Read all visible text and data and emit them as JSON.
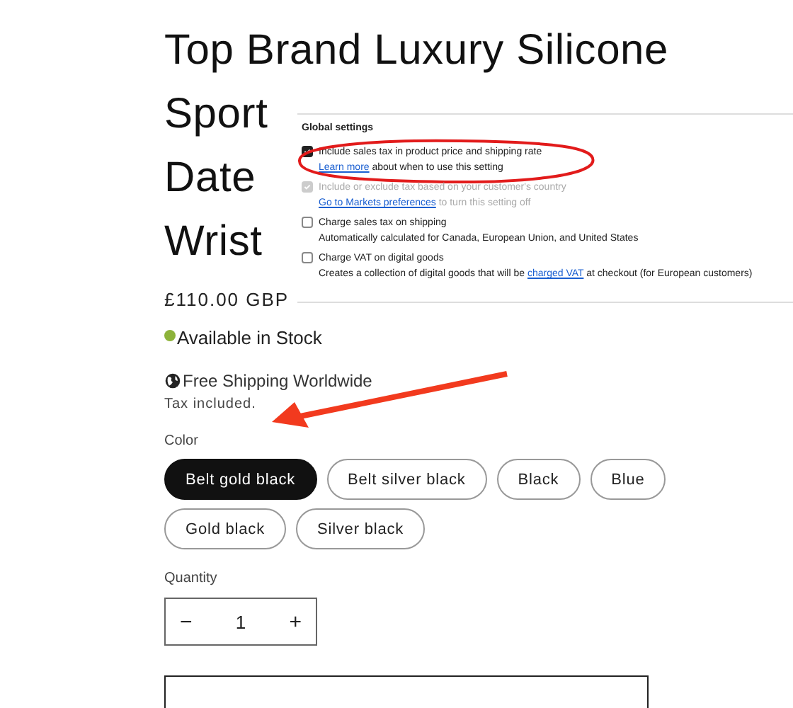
{
  "title_lines": [
    "Top Brand Luxury Silicone",
    "Sport",
    "Date",
    "Wrist"
  ],
  "price": "£110.00 GBP",
  "stock": {
    "label": "Available in Stock",
    "color": "#8db33a"
  },
  "shipping": "Free Shipping Worldwide",
  "tax_note": "Tax included.",
  "color_label": "Color",
  "colors": [
    {
      "label": "Belt gold black",
      "selected": true
    },
    {
      "label": "Belt silver black",
      "selected": false
    },
    {
      "label": "Black",
      "selected": false
    },
    {
      "label": "Blue",
      "selected": false
    },
    {
      "label": "Gold black",
      "selected": false
    },
    {
      "label": "Silver black",
      "selected": false
    }
  ],
  "quantity": {
    "label": "Quantity",
    "minus": "−",
    "value": "1",
    "plus": "+"
  },
  "settings": {
    "title": "Global settings",
    "items": [
      {
        "label": "Include sales tax in product price and shipping rate",
        "checked": true,
        "disabled": false,
        "link": "Learn more",
        "after": " about when to use this setting",
        "highlighted": true
      },
      {
        "label": "Include or exclude tax based on your customer's country",
        "checked": true,
        "disabled": true,
        "link": "Go to Markets preferences",
        "after": " to turn this setting off"
      },
      {
        "label": "Charge sales tax on shipping",
        "checked": false,
        "disabled": false,
        "before": "Automatically calculated for Canada, European Union, and United States"
      },
      {
        "label": "Charge VAT on digital goods",
        "checked": false,
        "disabled": false,
        "before": "Creates a collection of digital goods that will be ",
        "link": "charged VAT",
        "after": " at checkout (for European customers)"
      }
    ]
  }
}
